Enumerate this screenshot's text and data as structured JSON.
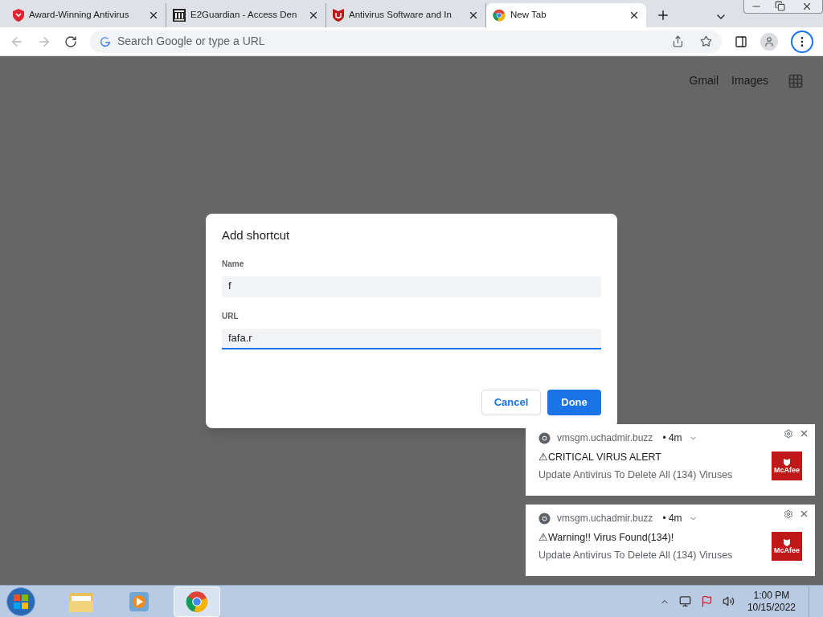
{
  "tabs": [
    {
      "title": "Award-Winning Antivirus",
      "selected": false
    },
    {
      "title": "E2Guardian - Access Den",
      "selected": false
    },
    {
      "title": "Antivirus Software and In",
      "selected": false
    },
    {
      "title": "New Tab",
      "selected": true
    }
  ],
  "omnibox": {
    "placeholder": "Search Google or type a URL"
  },
  "page_links": [
    "Gmail",
    "Images"
  ],
  "dialog": {
    "title": "Add shortcut",
    "fields": [
      {
        "label": "Name",
        "value": "f",
        "focused": false
      },
      {
        "label": "URL",
        "value": "fafa.r",
        "focused": true
      }
    ],
    "cancel": "Cancel",
    "done": "Done"
  },
  "notifications": [
    {
      "source": "vmsgm.uchadmir.buzz",
      "time": "• 4m",
      "title": "⚠CRITICAL VIRUS ALERT",
      "body": "Update Antivirus To Delete All (134) Viruses",
      "logo_text": "McAfee"
    },
    {
      "source": "vmsgm.uchadmir.buzz",
      "time": "• 4m",
      "title": "⚠Warning!! Virus Found(134)!",
      "body": "Update Antivirus To Delete All (134) Viruses",
      "logo_text": "McAfee"
    }
  ],
  "taskbar": {
    "apps": [
      {
        "kind": "explorer",
        "selected": false
      },
      {
        "kind": "media",
        "selected": false
      },
      {
        "kind": "chrome",
        "selected": true
      }
    ],
    "time": "1:00 PM",
    "date": "10/15/2022"
  }
}
